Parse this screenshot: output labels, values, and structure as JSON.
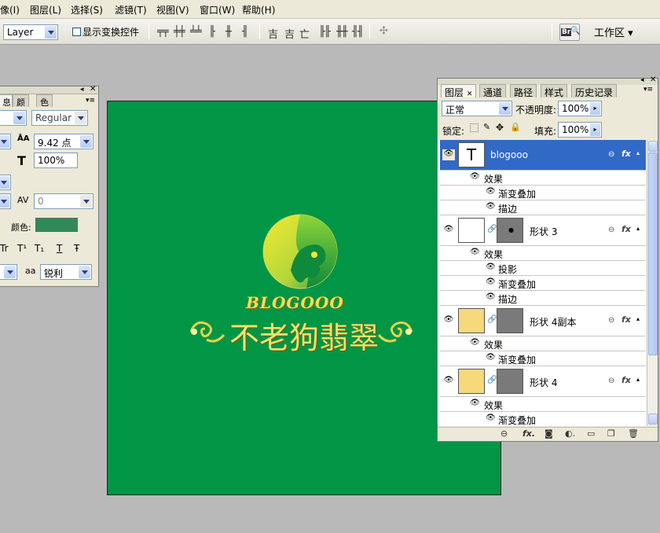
{
  "menu": [
    "像(I)",
    "图层(L)",
    "选择(S)",
    "滤镜(T)",
    "视图(V)",
    "窗口(W)",
    "帮助(H)"
  ],
  "options": {
    "layer_select": "Layer",
    "show_transform": "显示变换控件",
    "workspace": "工作区 ▾",
    "bridge_label": "Br"
  },
  "char_panel": {
    "tabs": [
      "息",
      "颜色",
      "色板"
    ],
    "font_style": "Regular",
    "leading": "9.42 点",
    "scale": "100%",
    "tracking": "0",
    "color_label": "颜色:",
    "antialias_label": "aa",
    "antialias": "锐利",
    "styles": [
      "Tr",
      "T¹",
      "T₁",
      "T",
      "Ŧ"
    ],
    "swatch_color": "#2e8b57"
  },
  "layers_panel": {
    "tabs": [
      "图层",
      "通道",
      "路径",
      "样式",
      "历史记录"
    ],
    "blend_mode": "正常",
    "opacity_label": "不透明度:",
    "opacity": "100%",
    "lock_label": "锁定:",
    "fill_label": "填充:",
    "fill": "100%",
    "layers": [
      {
        "name": "blogooo",
        "thumb": "T",
        "effects_label": "效果",
        "effects": [
          "渐变叠加",
          "描边"
        ]
      },
      {
        "name": "形状 3",
        "effects_label": "效果",
        "effects": [
          "投影",
          "渐变叠加",
          "描边"
        ]
      },
      {
        "name": "形状 4副本",
        "effects_label": "效果",
        "effects": [
          "渐变叠加"
        ]
      },
      {
        "name": "形状 4",
        "effects_label": "效果",
        "effects": [
          "渐变叠加"
        ]
      }
    ],
    "fx": "fx"
  },
  "canvas": {
    "bg_color": "#009645",
    "logo_text": "BLOGOOO",
    "logo_cn": "不老狗翡翠"
  }
}
